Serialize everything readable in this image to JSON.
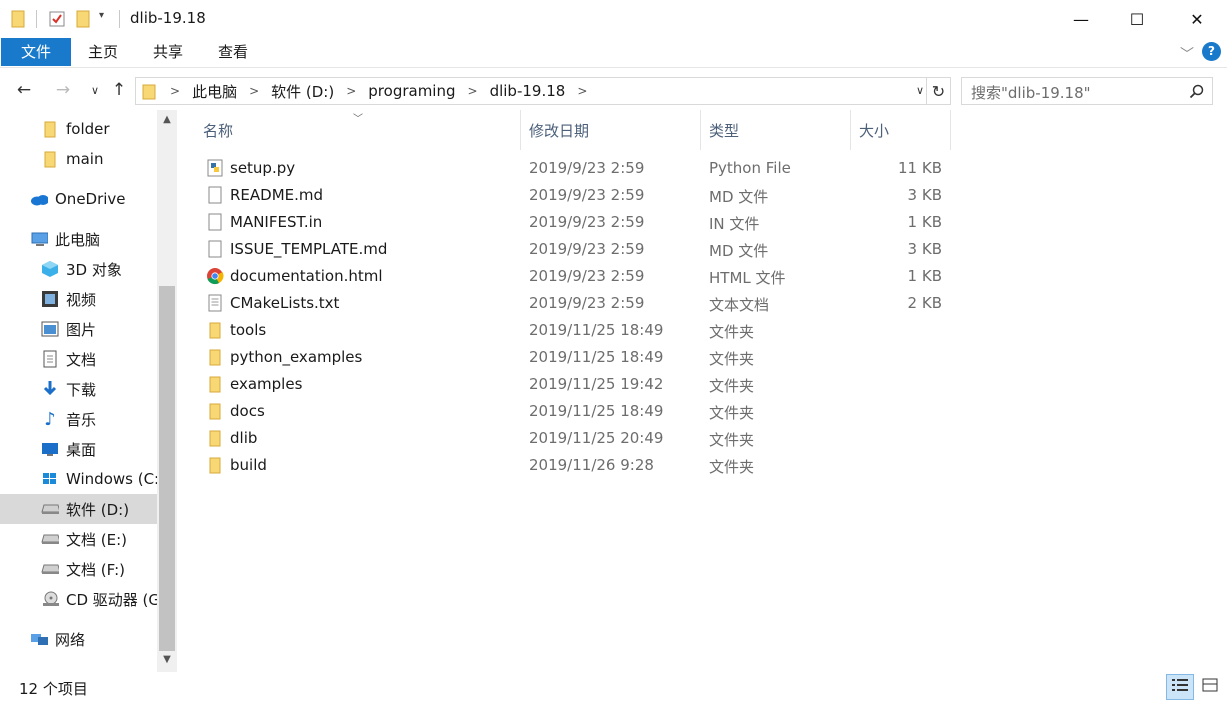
{
  "window": {
    "title": "dlib-19.18",
    "minimize_glyph": "—",
    "maximize_glyph": "☐",
    "close_glyph": "✕"
  },
  "ribbon": {
    "tabs": [
      "文件",
      "主页",
      "共享",
      "查看"
    ]
  },
  "address": {
    "breadcrumbs": [
      "此电脑",
      "软件 (D:)",
      "programing",
      "dlib-19.18"
    ],
    "search_placeholder": "搜索\"dlib-19.18\""
  },
  "sidebar": {
    "items": [
      {
        "label": "folder",
        "icon": "folder-icon"
      },
      {
        "label": "main",
        "icon": "folder-icon"
      },
      {
        "label": "OneDrive",
        "icon": "cloud-icon"
      },
      {
        "label": "此电脑",
        "icon": "computer-icon"
      },
      {
        "label": "3D 对象",
        "icon": "cube-icon"
      },
      {
        "label": "视频",
        "icon": "video-icon"
      },
      {
        "label": "图片",
        "icon": "picture-icon"
      },
      {
        "label": "文档",
        "icon": "document-icon"
      },
      {
        "label": "下载",
        "icon": "download-icon"
      },
      {
        "label": "音乐",
        "icon": "music-icon"
      },
      {
        "label": "桌面",
        "icon": "desktop-icon"
      },
      {
        "label": "Windows (C:",
        "icon": "windows-drive-icon"
      },
      {
        "label": "软件 (D:)",
        "icon": "drive-icon",
        "selected": true
      },
      {
        "label": "文档 (E:)",
        "icon": "drive-icon"
      },
      {
        "label": "文档 (F:)",
        "icon": "drive-icon"
      },
      {
        "label": "CD 驱动器 (G",
        "icon": "cd-drive-icon"
      },
      {
        "label": "网络",
        "icon": "network-icon"
      }
    ]
  },
  "columns": {
    "name": "名称",
    "date": "修改日期",
    "type": "类型",
    "size": "大小"
  },
  "files": [
    {
      "name": "setup.py",
      "date": "2019/9/23 2:59",
      "type": "Python File",
      "size": "11 KB",
      "icon": "python-file-icon"
    },
    {
      "name": "README.md",
      "date": "2019/9/23 2:59",
      "type": "MD 文件",
      "size": "3 KB",
      "icon": "file-icon"
    },
    {
      "name": "MANIFEST.in",
      "date": "2019/9/23 2:59",
      "type": "IN 文件",
      "size": "1 KB",
      "icon": "file-icon"
    },
    {
      "name": "ISSUE_TEMPLATE.md",
      "date": "2019/9/23 2:59",
      "type": "MD 文件",
      "size": "3 KB",
      "icon": "file-icon"
    },
    {
      "name": "documentation.html",
      "date": "2019/9/23 2:59",
      "type": "HTML 文件",
      "size": "1 KB",
      "icon": "chrome-icon"
    },
    {
      "name": "CMakeLists.txt",
      "date": "2019/9/23 2:59",
      "type": "文本文档",
      "size": "2 KB",
      "icon": "text-file-icon"
    },
    {
      "name": "tools",
      "date": "2019/11/25 18:49",
      "type": "文件夹",
      "size": "",
      "icon": "folder-icon"
    },
    {
      "name": "python_examples",
      "date": "2019/11/25 18:49",
      "type": "文件夹",
      "size": "",
      "icon": "folder-icon"
    },
    {
      "name": "examples",
      "date": "2019/11/25 19:42",
      "type": "文件夹",
      "size": "",
      "icon": "folder-icon"
    },
    {
      "name": "docs",
      "date": "2019/11/25 18:49",
      "type": "文件夹",
      "size": "",
      "icon": "folder-icon"
    },
    {
      "name": "dlib",
      "date": "2019/11/25 20:49",
      "type": "文件夹",
      "size": "",
      "icon": "folder-icon"
    },
    {
      "name": "build",
      "date": "2019/11/26 9:28",
      "type": "文件夹",
      "size": "",
      "icon": "folder-icon"
    }
  ],
  "status": {
    "item_count": "12 个项目"
  },
  "colors": {
    "accent": "#1979ca",
    "folder": "#f8d775",
    "selected_bg": "#d9d9d9",
    "header_text": "#4c607a"
  }
}
